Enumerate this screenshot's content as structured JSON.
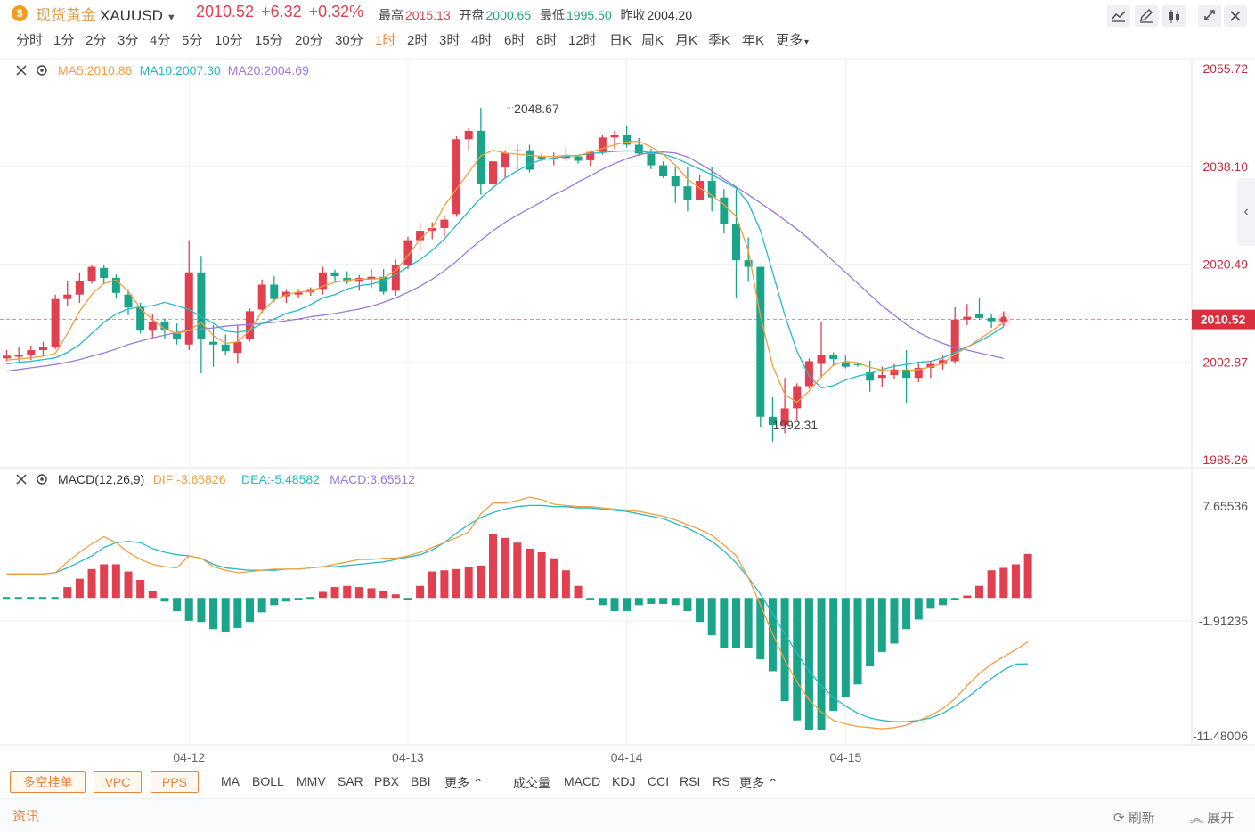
{
  "header": {
    "logo_glyph": "$",
    "name": "现货黄金",
    "symbol": "XAUUSD",
    "last": "2010.52",
    "change": "+6.32",
    "change_pct": "+0.32%",
    "high_label": "最高",
    "high": "2015.13",
    "open_label": "开盘",
    "open": "2000.65",
    "low_label": "最低",
    "low": "1995.50",
    "prev_label": "昨收",
    "prev": "2004.20"
  },
  "periods": [
    "分时",
    "1分",
    "2分",
    "3分",
    "4分",
    "5分",
    "10分",
    "15分",
    "20分",
    "30分",
    "1时",
    "2时",
    "3时",
    "4时",
    "6时",
    "8时",
    "12时",
    "日K",
    "周K",
    "月K",
    "季K",
    "年K"
  ],
  "period_more": "更多",
  "active_period": "1时",
  "toolbar_icons": [
    "line-icon",
    "draw-icon",
    "candle-type-icon",
    "fullscreen-icon",
    "close-icon"
  ],
  "colors": {
    "up": "#e04050",
    "down": "#1aa58a",
    "ma5": "#f0a040",
    "ma10": "#27b8c8",
    "ma20": "#9a7ad8",
    "accent": "#e9833a"
  },
  "bottom": {
    "overlay_buttons": [
      "多空挂单",
      "VPC",
      "PPS"
    ],
    "main_indicators": [
      "MA",
      "BOLL",
      "MMV",
      "SAR",
      "PBX",
      "BBI"
    ],
    "more_label": "更多",
    "sub_indicators": [
      "成交量",
      "MACD",
      "KDJ",
      "CCI",
      "RSI",
      "RS"
    ]
  },
  "news": {
    "label": "资讯",
    "refresh": "刷新",
    "expand": "展开"
  },
  "chart_data": [
    {
      "type": "candlestick",
      "title": "",
      "legend": {
        "ma5": "MA5:2010.86",
        "ma10": "MA10:2007.30",
        "ma20": "MA20:2004.69"
      },
      "y_ticks": [
        "2055.72",
        "2038.10",
        "2020.49",
        "2002.87",
        "1985.26"
      ],
      "ylim": [
        1985.26,
        2055.72
      ],
      "x_tick_labels": [
        {
          "at": 15,
          "label": "04-12"
        },
        {
          "at": 33,
          "label": "04-13"
        },
        {
          "at": 51,
          "label": "04-14"
        },
        {
          "at": 69,
          "label": "04-15"
        }
      ],
      "last_price": "2010.52",
      "annotations": [
        {
          "index": 41,
          "label": "2048.67",
          "value": 2048.67
        },
        {
          "index": 67,
          "label": "1992.31",
          "value": 1992.31
        }
      ],
      "ohlc": [
        [
          2003.5,
          2005.0,
          2003.0,
          2004.0
        ],
        [
          2003.8,
          2005.5,
          2003.0,
          2004.2
        ],
        [
          2004.2,
          2005.8,
          2003.2,
          2005.0
        ],
        [
          2005.0,
          2006.5,
          2004.0,
          2005.5
        ],
        [
          2005.5,
          2015.0,
          2005.2,
          2014.2
        ],
        [
          2014.2,
          2017.5,
          2013.0,
          2015.0
        ],
        [
          2015.0,
          2019.0,
          2013.5,
          2017.5
        ],
        [
          2017.5,
          2020.3,
          2017.0,
          2020.0
        ],
        [
          2019.8,
          2020.3,
          2016.8,
          2018.0
        ],
        [
          2018.0,
          2018.6,
          2014.3,
          2015.3
        ],
        [
          2015.0,
          2016.0,
          2011.3,
          2012.7
        ],
        [
          2012.7,
          2013.5,
          2008.0,
          2008.5
        ],
        [
          2008.5,
          2011.5,
          2007.3,
          2010.0
        ],
        [
          2010.0,
          2010.7,
          2007.0,
          2008.6
        ],
        [
          2008.0,
          2009.8,
          2006.0,
          2007.0
        ],
        [
          2006.0,
          2024.8,
          2005.0,
          2019.0
        ],
        [
          2019.0,
          2022.0,
          2000.8,
          2007.0
        ],
        [
          2006.5,
          2009.5,
          2002.0,
          2006.0
        ],
        [
          2006.0,
          2007.8,
          2004.0,
          2004.8
        ],
        [
          2004.5,
          2009.5,
          2002.5,
          2006.5
        ],
        [
          2007.0,
          2012.5,
          2006.5,
          2012.0
        ],
        [
          2012.3,
          2017.7,
          2011.7,
          2016.8
        ],
        [
          2016.8,
          2018.3,
          2013.7,
          2014.2
        ],
        [
          2014.7,
          2016.0,
          2013.5,
          2015.5
        ],
        [
          2015.0,
          2016.0,
          2014.4,
          2015.4
        ],
        [
          2015.4,
          2016.3,
          2014.8,
          2016.0
        ],
        [
          2016.0,
          2020.0,
          2015.0,
          2019.0
        ],
        [
          2019.0,
          2019.5,
          2017.3,
          2018.3
        ],
        [
          2018.0,
          2019.2,
          2016.9,
          2017.3
        ],
        [
          2017.3,
          2018.5,
          2015.7,
          2018.0
        ],
        [
          2017.8,
          2019.6,
          2016.3,
          2018.2
        ],
        [
          2018.2,
          2019.6,
          2015.0,
          2015.5
        ],
        [
          2015.7,
          2021.3,
          2014.8,
          2020.3
        ],
        [
          2020.3,
          2025.4,
          2019.6,
          2024.8
        ],
        [
          2024.8,
          2028.0,
          2022.9,
          2026.5
        ],
        [
          2026.5,
          2028.0,
          2025.0,
          2027.0
        ],
        [
          2027.0,
          2029.3,
          2025.4,
          2028.5
        ],
        [
          2029.5,
          2043.5,
          2029.0,
          2043.0
        ],
        [
          2043.0,
          2045.0,
          2041.0,
          2044.5
        ],
        [
          2044.5,
          2048.67,
          2033.0,
          2035.0
        ],
        [
          2035.0,
          2039.0,
          2033.8,
          2039.0
        ],
        [
          2038.0,
          2041.0,
          2036.0,
          2040.5
        ],
        [
          2040.8,
          2042.0,
          2037.5,
          2041.0
        ],
        [
          2041.0,
          2042.0,
          2037.0,
          2037.5
        ],
        [
          2039.8,
          2040.3,
          2039.0,
          2039.5
        ],
        [
          2039.5,
          2040.6,
          2038.3,
          2039.6
        ],
        [
          2039.6,
          2041.7,
          2039.0,
          2039.9
        ],
        [
          2039.9,
          2040.1,
          2038.6,
          2039.1
        ],
        [
          2039.2,
          2041.0,
          2038.2,
          2040.7
        ],
        [
          2040.7,
          2043.7,
          2040.2,
          2043.3
        ],
        [
          2043.3,
          2044.5,
          2041.2,
          2043.7
        ],
        [
          2043.7,
          2045.5,
          2041.5,
          2042.0
        ],
        [
          2042.0,
          2043.2,
          2040.0,
          2040.4
        ],
        [
          2040.4,
          2041.3,
          2037.6,
          2038.3
        ],
        [
          2038.3,
          2039.0,
          2036.0,
          2036.3
        ],
        [
          2036.3,
          2038.0,
          2031.5,
          2034.5
        ],
        [
          2034.5,
          2038.0,
          2030.0,
          2032.0
        ],
        [
          2032.0,
          2036.5,
          2032.0,
          2035.5
        ],
        [
          2035.5,
          2038.0,
          2030.0,
          2032.5
        ],
        [
          2032.5,
          2034.0,
          2026.0,
          2027.7
        ],
        [
          2027.7,
          2034.0,
          2014.3,
          2021.2
        ],
        [
          2021.2,
          2025.3,
          2017.3,
          2020.0
        ],
        [
          2020.0,
          2020.0,
          1991.2,
          1993.0
        ],
        [
          1993.0,
          1996.5,
          1988.5,
          1991.5
        ],
        [
          1991.5,
          2000.0,
          1990.0,
          1994.5
        ],
        [
          1994.5,
          1999.0,
          1992.31,
          1998.5
        ],
        [
          1998.5,
          2003.5,
          1998.0,
          2003.0
        ],
        [
          2002.5,
          2010.0,
          2000.0,
          2004.2
        ],
        [
          2004.2,
          2004.6,
          2002.1,
          2003.4
        ],
        [
          2002.8,
          2004.0,
          2001.7,
          2002.0
        ],
        [
          2002.5,
          2002.8,
          2002.0,
          2002.4
        ],
        [
          2001.0,
          2003.1,
          1997.5,
          1999.5
        ],
        [
          2000.0,
          2002.0,
          1998.4,
          2000.5
        ],
        [
          2000.5,
          2002.5,
          1999.8,
          2001.5
        ],
        [
          2001.5,
          2005.0,
          1995.5,
          2000.0
        ],
        [
          2000.0,
          2002.9,
          1999.2,
          2001.8
        ],
        [
          2001.8,
          2003.0,
          2000.0,
          2002.5
        ],
        [
          2002.5,
          2004.0,
          2001.5,
          2003.2
        ],
        [
          2003.0,
          2012.7,
          2002.5,
          2010.5
        ],
        [
          2010.5,
          2013.3,
          2009.5,
          2011.0
        ],
        [
          2011.5,
          2014.5,
          2010.5,
          2010.8
        ],
        [
          2010.8,
          2011.6,
          2009.0,
          2010.2
        ],
        [
          2010.2,
          2012.0,
          2009.3,
          2010.52
        ]
      ],
      "ma5": [
        2003.2,
        2003.4,
        2003.6,
        2003.9,
        2004.4,
        2008.0,
        2012.0,
        2015.0,
        2017.0,
        2017.6,
        2015.6,
        2012.5,
        2010.5,
        2008.8,
        2008.0,
        2008.5,
        2010.0,
        2007.6,
        2006.2,
        2006.5,
        2008.6,
        2012.0,
        2014.0,
        2015.0,
        2015.5,
        2015.6,
        2016.5,
        2017.2,
        2017.6,
        2017.8,
        2017.8,
        2018.0,
        2019.3,
        2022.0,
        2025.0,
        2027.0,
        2031.0,
        2034.0,
        2037.0,
        2040.0,
        2041.0,
        2040.5,
        2040.3,
        2040.1,
        2039.9,
        2039.9,
        2040.1,
        2040.0,
        2040.7,
        2041.3,
        2042.0,
        2042.5,
        2042.6,
        2041.6,
        2040.3,
        2038.3,
        2035.8,
        2034.2,
        2032.9,
        2031.2,
        2029.1,
        2023.0,
        2011.1,
        2002.2,
        1997.0,
        1995.6,
        1997.6,
        2000.2,
        2002.3,
        2003.0,
        2002.7,
        2001.9,
        2001.4,
        2001.2,
        2001.3,
        2001.5,
        2002.0,
        2002.6,
        2004.3,
        2005.5,
        2007.0,
        2008.4,
        2010.0
      ],
      "ma10": [
        2002.5,
        2002.8,
        2003.0,
        2003.3,
        2003.6,
        2004.6,
        2006.0,
        2008.0,
        2010.0,
        2011.5,
        2012.4,
        2012.8,
        2013.0,
        2013.6,
        2013.0,
        2012.3,
        2011.0,
        2009.8,
        2008.4,
        2008.2,
        2008.6,
        2009.8,
        2010.6,
        2011.6,
        2012.2,
        2013.2,
        2014.4,
        2015.0,
        2016.0,
        2016.6,
        2016.9,
        2017.5,
        2018.6,
        2020.0,
        2021.3,
        2023.0,
        2025.0,
        2027.5,
        2030.0,
        2032.4,
        2034.3,
        2036.0,
        2037.3,
        2038.5,
        2039.3,
        2039.6,
        2039.9,
        2040.1,
        2040.4,
        2040.6,
        2040.8,
        2040.9,
        2040.8,
        2040.6,
        2040.3,
        2039.6,
        2038.6,
        2037.6,
        2036.6,
        2035.4,
        2034.2,
        2031.5,
        2026.5,
        2019.0,
        2011.3,
        2004.8,
        2000.3,
        1998.2,
        1998.6,
        1999.6,
        2000.3,
        2000.8,
        2001.5,
        2002.1,
        2002.4,
        2002.8,
        2003.0,
        2003.6,
        2004.6,
        2005.6,
        2006.6,
        2007.8,
        2009.2
      ],
      "ma20": [
        2001.2,
        2001.5,
        2001.8,
        2002.1,
        2002.4,
        2002.8,
        2003.3,
        2003.9,
        2004.5,
        2005.2,
        2006.0,
        2006.6,
        2007.2,
        2007.7,
        2008.2,
        2008.5,
        2008.8,
        2009.0,
        2009.3,
        2009.5,
        2009.6,
        2009.8,
        2010.0,
        2010.3,
        2010.6,
        2011.0,
        2011.3,
        2011.6,
        2012.0,
        2012.4,
        2012.9,
        2013.6,
        2014.4,
        2015.4,
        2016.5,
        2017.8,
        2019.3,
        2021.0,
        2023.0,
        2024.8,
        2026.5,
        2028.0,
        2029.3,
        2030.5,
        2031.7,
        2033.0,
        2034.0,
        2035.3,
        2036.4,
        2037.6,
        2038.6,
        2039.5,
        2040.2,
        2040.6,
        2040.7,
        2040.5,
        2039.8,
        2038.6,
        2037.3,
        2035.8,
        2034.4,
        2033.0,
        2031.5,
        2030.0,
        2028.4,
        2026.8,
        2025.0,
        2023.0,
        2021.0,
        2019.0,
        2017.0,
        2015.0,
        2013.0,
        2011.3,
        2009.6,
        2008.2,
        2007.1,
        2006.2,
        2005.5,
        2005.0,
        2004.5,
        2004.0,
        2003.5
      ]
    },
    {
      "type": "bar+line",
      "title": "",
      "legend": {
        "name": "MACD(12,26,9)",
        "dif": "DIF:-3.65826",
        "dea": "DEA:-5.48582",
        "macd": "MACD:3.65512"
      },
      "y_ticks": [
        "7.65536",
        "-1.91235",
        "-11.48006"
      ],
      "ylim": [
        -11.48006,
        7.65536
      ],
      "dif": [
        2.0,
        2.0,
        2.0,
        2.0,
        2.1,
        3.0,
        3.8,
        4.5,
        5.1,
        4.6,
        3.8,
        3.2,
        2.8,
        2.6,
        2.5,
        3.5,
        3.3,
        2.6,
        2.3,
        2.1,
        2.2,
        2.3,
        2.4,
        2.4,
        2.4,
        2.5,
        2.6,
        2.8,
        3.0,
        3.2,
        3.2,
        3.3,
        3.3,
        3.5,
        3.8,
        4.2,
        4.6,
        5.0,
        5.5,
        7.0,
        7.9,
        7.9,
        8.1,
        8.4,
        8.2,
        7.8,
        7.7,
        7.6,
        7.6,
        7.5,
        7.4,
        7.3,
        7.2,
        7.0,
        6.8,
        6.5,
        6.1,
        5.7,
        5.2,
        4.4,
        3.5,
        1.7,
        -0.6,
        -3.0,
        -5.2,
        -7.0,
        -8.5,
        -9.5,
        -10.2,
        -10.5,
        -10.7,
        -10.8,
        -10.9,
        -10.8,
        -10.6,
        -10.2,
        -9.8,
        -9.2,
        -8.4,
        -7.3,
        -6.3,
        -5.5,
        -4.9,
        -4.3,
        -3.66
      ],
      "dea": [
        2.0,
        2.0,
        2.0,
        2.0,
        2.1,
        2.5,
        3.0,
        3.5,
        4.2,
        4.6,
        4.7,
        4.6,
        4.1,
        3.8,
        3.6,
        3.5,
        3.3,
        2.8,
        2.5,
        2.4,
        2.3,
        2.3,
        2.3,
        2.4,
        2.4,
        2.5,
        2.6,
        2.6,
        2.7,
        2.8,
        2.9,
        3.0,
        3.2,
        3.4,
        3.6,
        4.0,
        4.6,
        5.4,
        6.1,
        6.7,
        7.1,
        7.4,
        7.6,
        7.7,
        7.7,
        7.6,
        7.6,
        7.5,
        7.5,
        7.4,
        7.3,
        7.2,
        7.0,
        6.8,
        6.6,
        6.2,
        5.8,
        5.3,
        4.7,
        3.9,
        2.9,
        1.7,
        0.3,
        -1.3,
        -3.0,
        -4.6,
        -6.1,
        -7.3,
        -8.3,
        -9.0,
        -9.6,
        -10.0,
        -10.2,
        -10.3,
        -10.3,
        -10.2,
        -10.0,
        -9.6,
        -9.0,
        -8.3,
        -7.5,
        -6.7,
        -6.0,
        -5.5,
        -5.49
      ],
      "macd": [
        -0.1,
        -0.1,
        -0.1,
        -0.1,
        -0.1,
        0.9,
        1.6,
        2.4,
        2.8,
        2.8,
        2.2,
        1.5,
        0.6,
        -0.3,
        -1.1,
        -1.9,
        -2.0,
        -2.6,
        -2.8,
        -2.5,
        -2.0,
        -1.2,
        -0.6,
        -0.3,
        -0.2,
        -0.1,
        0.5,
        0.9,
        1.0,
        0.9,
        0.8,
        0.6,
        0.3,
        -0.2,
        1.0,
        2.2,
        2.3,
        2.4,
        2.6,
        2.7,
        5.3,
        5.0,
        4.6,
        4.1,
        3.8,
        3.3,
        2.3,
        1.0,
        -0.2,
        -0.6,
        -1.1,
        -1.1,
        -0.6,
        -0.5,
        -0.5,
        -0.6,
        -1.1,
        -2.0,
        -3.1,
        -4.2,
        -4.2,
        -4.2,
        -5.1,
        -6.1,
        -8.6,
        -10.2,
        -11.0,
        -11.0,
        -9.4,
        -8.3,
        -7.2,
        -5.7,
        -4.5,
        -3.8,
        -2.6,
        -1.8,
        -0.9,
        -0.6,
        -0.2,
        0.2,
        1.0,
        2.3,
        2.5,
        2.8,
        3.66
      ]
    }
  ]
}
